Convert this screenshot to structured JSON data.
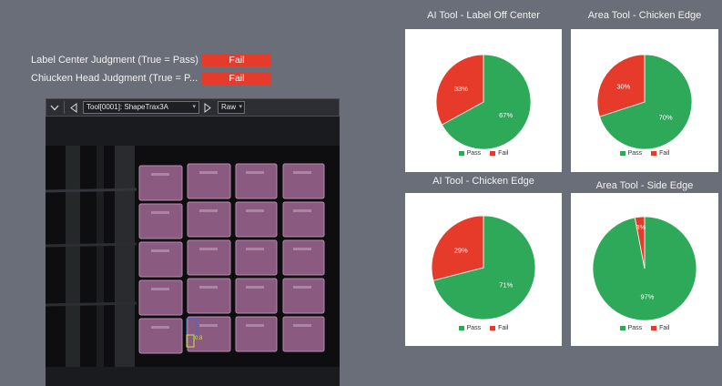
{
  "judgments": [
    {
      "label": "Label Center Judgment (True = Pass)",
      "value": "Fail"
    },
    {
      "label": "Chiucken Head Judgment (True = P...",
      "value": "Fail"
    }
  ],
  "viewer": {
    "tool_select": "Tool[0001]: ShapeTrax3A",
    "view_mode": "Raw",
    "detection_score": "0.8"
  },
  "colors": {
    "pass": "#2ea859",
    "fail": "#e63b2a"
  },
  "chart_data": [
    {
      "type": "pie",
      "title": "AI Tool - Label Off Center",
      "categories": [
        "Pass",
        "Fail"
      ],
      "values": [
        67,
        33
      ],
      "labels": [
        "67%",
        "33%"
      ],
      "legend_placement": "bottom"
    },
    {
      "type": "pie",
      "title": "Area Tool - Chicken Edge",
      "categories": [
        "Pass",
        "Fail"
      ],
      "values": [
        70,
        30
      ],
      "labels": [
        "70%",
        "30%"
      ],
      "legend_placement": "bottom"
    },
    {
      "type": "pie",
      "title": "AI Tool - Chicken Edge",
      "categories": [
        "Pass",
        "Fail"
      ],
      "values": [
        71,
        29
      ],
      "labels": [
        "71%",
        "29%"
      ],
      "legend_placement": "bottom"
    },
    {
      "type": "pie",
      "title": "Area Tool - Side Edge",
      "categories": [
        "Pass",
        "Fail"
      ],
      "values": [
        97,
        3
      ],
      "labels": [
        "97%",
        "3%"
      ],
      "legend_placement": "bottom"
    }
  ]
}
